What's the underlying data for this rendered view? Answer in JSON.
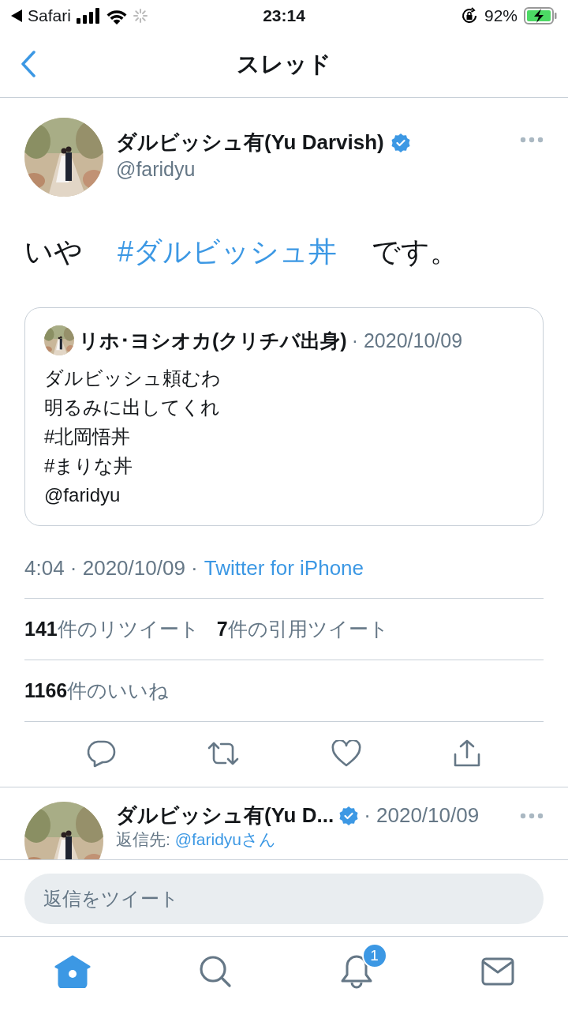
{
  "status_bar": {
    "back_app": "Safari",
    "time": "23:14",
    "battery": "92%"
  },
  "nav": {
    "title": "スレッド"
  },
  "tweet": {
    "author": {
      "name": "ダルビッシュ有(Yu Darvish)",
      "handle": "@faridyu",
      "verified": true
    },
    "text": [
      {
        "kind": "plain",
        "text": "いや"
      },
      {
        "kind": "hashtag",
        "text": "#ダルビッシュ丼"
      },
      {
        "kind": "plain",
        "text": "です。"
      }
    ],
    "quote": {
      "author": "リホ･ヨシオカ(クリチバ出身)",
      "date": "· 2020/10/09",
      "lines": [
        "ダルビッシュ頼むわ",
        "明るみに出してくれ",
        "#北岡悟丼",
        "#まりな丼",
        "@faridyu"
      ]
    },
    "meta": {
      "time": "4:04 · 2020/10/09 ·",
      "source": "Twitter for iPhone"
    },
    "stats": [
      [
        "**141**件のリツイート",
        "**7**件の引用ツイート"
      ],
      [
        "**1166**件のいいね"
      ]
    ]
  },
  "reply": {
    "name": "ダルビッシュ有(Yu D...",
    "verified": true,
    "date": "· 2020/10/09",
    "reply_to_label": "返信先:",
    "reply_to": "@faridyuさん"
  },
  "composer": {
    "placeholder": "返信をツイート"
  },
  "tab_bar": [
    {
      "kind": "home",
      "selected": true
    },
    {
      "kind": "search",
      "selected": false
    },
    {
      "kind": "notifications",
      "selected": false,
      "badge": "1"
    },
    {
      "kind": "messages",
      "selected": false
    }
  ]
}
